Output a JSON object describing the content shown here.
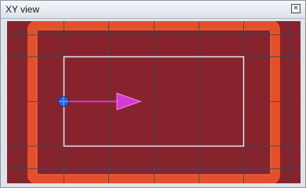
{
  "window": {
    "title": "XY view",
    "close_glyph": "×"
  },
  "colors": {
    "background": "#86232d",
    "slab_outer": "#e3502b",
    "slab_inner": "#f36d3c",
    "grid": "#3a4a5a",
    "selection": "#e8e8f0",
    "arrow": "#d43ad0",
    "handle": "#2d5fd8"
  },
  "icons": {
    "close": "close-icon",
    "arrow": "direction-arrow-icon",
    "handle": "control-point-icon"
  }
}
